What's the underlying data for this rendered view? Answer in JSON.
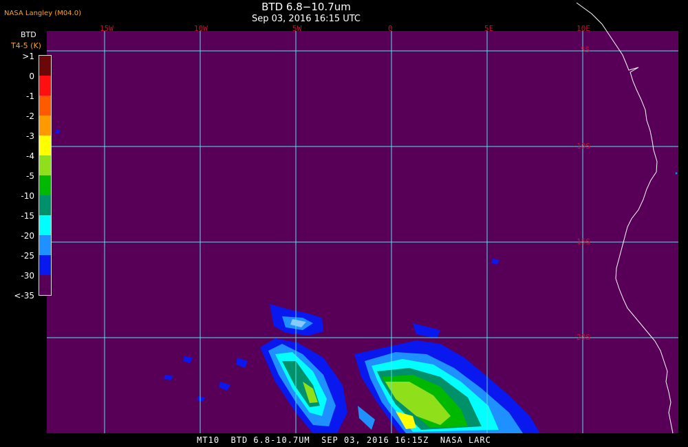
{
  "header": {
    "title": "BTD 6.8−10.7um",
    "subtitle": "Sep 03, 2016 16:15 UTC",
    "org": "NASA Langley (M04.0)"
  },
  "legend": {
    "title": "BTD",
    "unit": "T4-5 (K)",
    "ticks": [
      ">1",
      "0",
      "-1",
      "-2",
      "-3",
      "-4",
      "-5",
      "-10",
      "-15",
      "-20",
      "-25",
      "-30",
      "<-35"
    ],
    "colors": [
      "#6b0707",
      "#ff1010",
      "#ff5a00",
      "#ff9900",
      "#ffff00",
      "#8fe01a",
      "#00b800",
      "#00906a",
      "#00ffff",
      "#1e90ff",
      "#0a18f0",
      "#580058"
    ]
  },
  "map": {
    "background_color": "#580058",
    "grid_color": "#50e6e6",
    "coast_color": "#ffffff",
    "lon_labels": [
      "15W",
      "10W",
      "5W",
      "0",
      "5E",
      "10E"
    ],
    "lat_labels": [
      "5S",
      "10S",
      "15S",
      "20S"
    ]
  },
  "footer": {
    "text": "MT10  BTD 6.8-10.7UM  SEP 03, 2016 16:15Z  NASA LARC"
  }
}
